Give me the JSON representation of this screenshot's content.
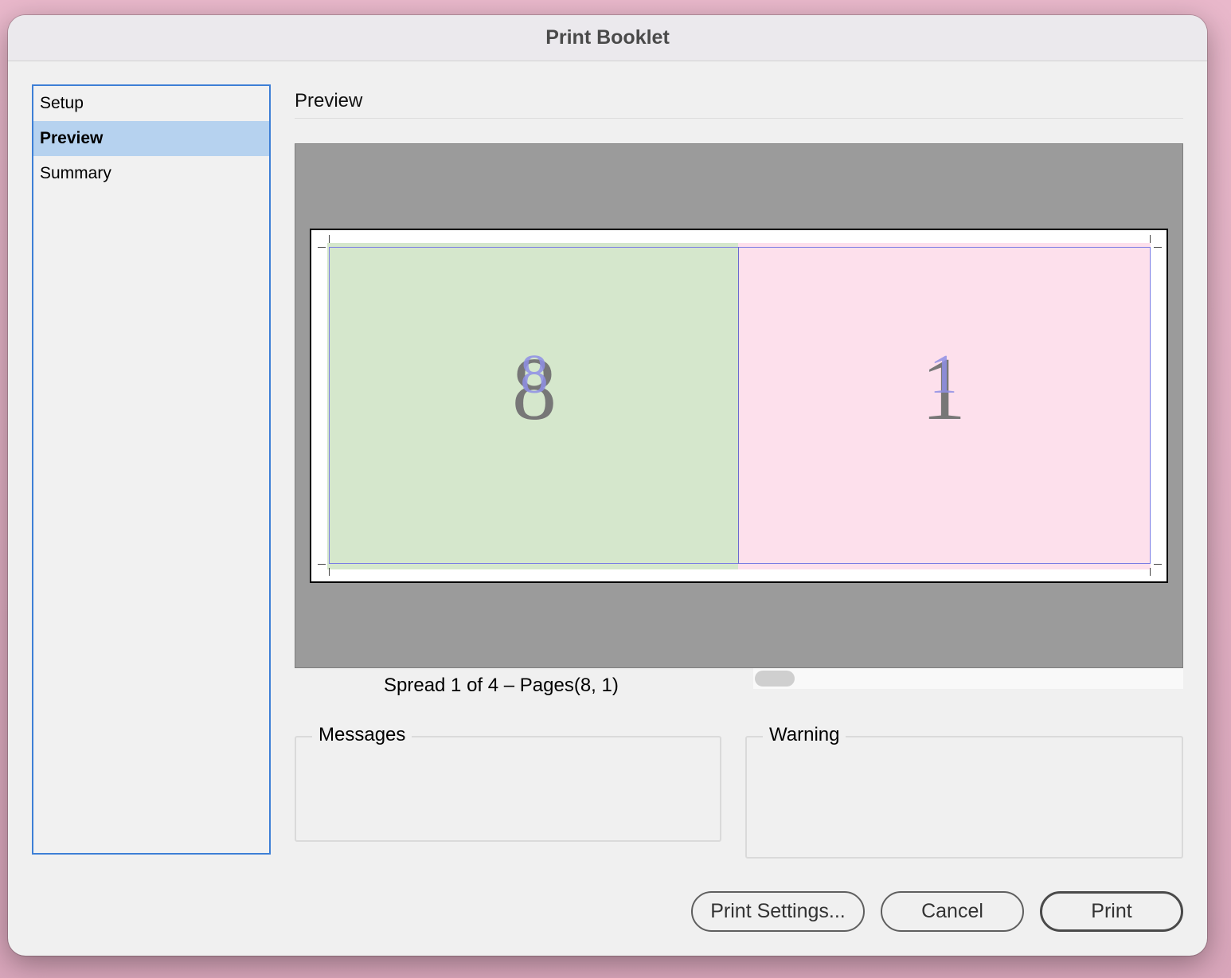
{
  "window": {
    "title": "Print Booklet"
  },
  "sidebar": {
    "items": [
      {
        "label": "Setup"
      },
      {
        "label": "Preview"
      },
      {
        "label": "Summary"
      }
    ]
  },
  "section": {
    "title": "Preview"
  },
  "preview": {
    "left_page_number": "8",
    "right_page_number": "1",
    "left_page_color": "#d5e7cc",
    "right_page_color": "#fde0ec",
    "spread_label": "Spread 1 of 4 – Pages(8, 1)"
  },
  "messages": {
    "legend": "Messages"
  },
  "warning": {
    "legend": "Warning"
  },
  "buttons": {
    "print_settings": "Print Settings...",
    "cancel": "Cancel",
    "print": "Print"
  },
  "colors": {
    "accent": "#3d7fd6",
    "selection": "#b6d2ef"
  }
}
